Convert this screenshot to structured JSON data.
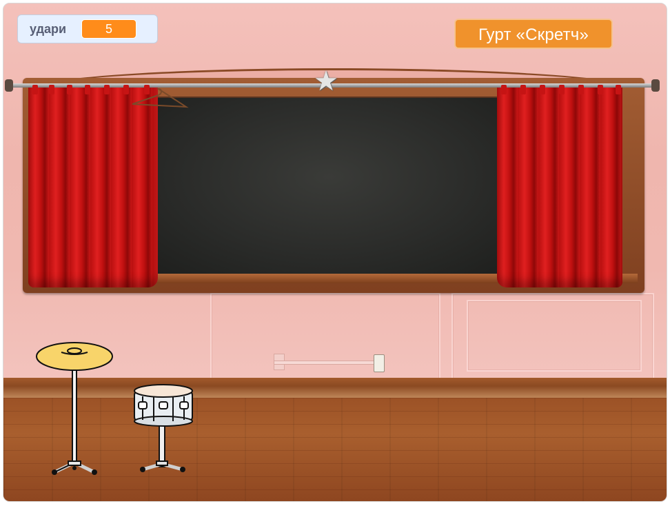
{
  "stage": {
    "backdrop": "stage-with-curtains",
    "colors": {
      "wall": "#f1b9b3",
      "curtain": "#d01515",
      "floor": "#9c5226",
      "monitor_accent": "#ff8c1a",
      "sign": "#f0922c"
    }
  },
  "monitor": {
    "label": "удари",
    "value": "5"
  },
  "sign": {
    "text": "Гурт «Скретч»"
  },
  "sprites": [
    {
      "name": "cymbal",
      "icon": "cymbal-icon"
    },
    {
      "name": "drum",
      "icon": "snare-drum-icon"
    },
    {
      "name": "star",
      "icon": "star-icon"
    }
  ]
}
